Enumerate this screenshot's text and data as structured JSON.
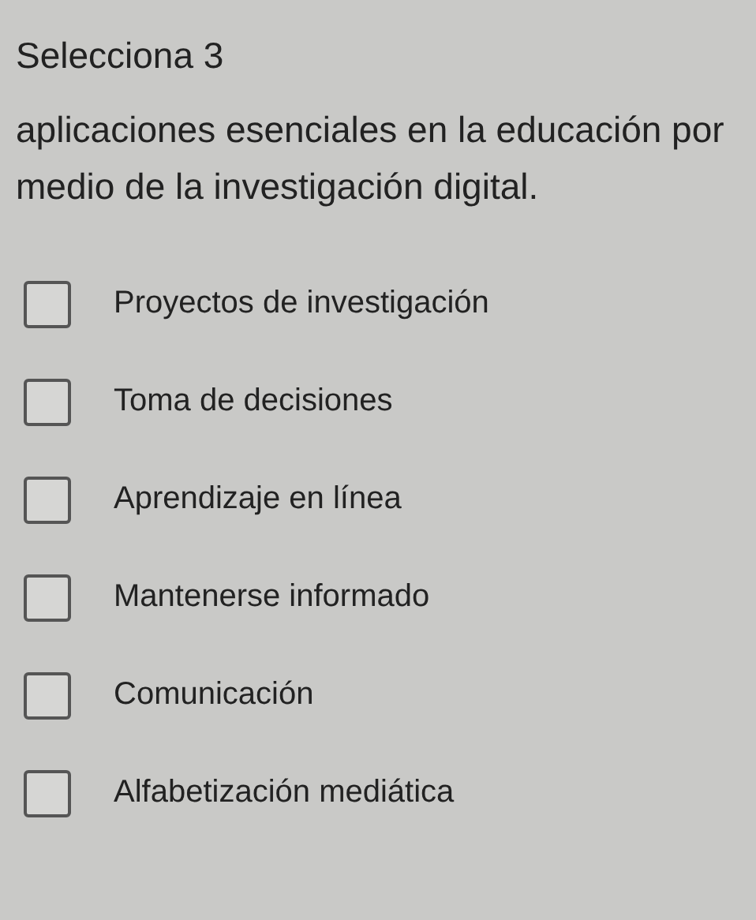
{
  "title": "Selecciona 3",
  "question": "aplicaciones esenciales en la educación por medio de la investigación digital.",
  "options": [
    {
      "label": "Proyectos de investigación",
      "checked": false
    },
    {
      "label": "Toma de decisiones",
      "checked": false
    },
    {
      "label": "Aprendizaje en línea",
      "checked": false
    },
    {
      "label": "Mantenerse informado",
      "checked": false
    },
    {
      "label": "Comunicación",
      "checked": false
    },
    {
      "label": "Alfabetización mediática",
      "checked": false
    }
  ]
}
